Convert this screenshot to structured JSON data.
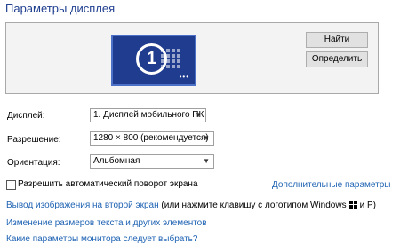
{
  "header": {
    "title": "Параметры дисплея"
  },
  "preview": {
    "monitor_number": "1",
    "find_label": "Найти",
    "identify_label": "Определить"
  },
  "settings": {
    "display_label": "Дисплей:",
    "display_value": "1. Дисплей мобильного ПК",
    "resolution_label": "Разрешение:",
    "resolution_value": "1280 × 800 (рекомендуется)",
    "orientation_label": "Ориентация:",
    "orientation_value": "Альбомная"
  },
  "auto_rotate": {
    "label": "Разрешить автоматический поворот экрана",
    "checked": false
  },
  "links": {
    "advanced": "Дополнительные параметры",
    "second_screen": "Вывод изображения на второй экран",
    "second_screen_hint_a": "(или нажмите клавишу с логотипом Windows",
    "second_screen_hint_b": "и P)",
    "text_size": "Изменение размеров текста и других элементов",
    "which_settings": "Какие параметры монитора следует выбрать?"
  },
  "icons": {
    "dropdown": "chevron-down-icon",
    "windows_logo": "windows-logo-icon"
  },
  "colors": {
    "link": "#1f63b3",
    "title": "#1f3f8f",
    "monitor": "#1f3c8e"
  }
}
